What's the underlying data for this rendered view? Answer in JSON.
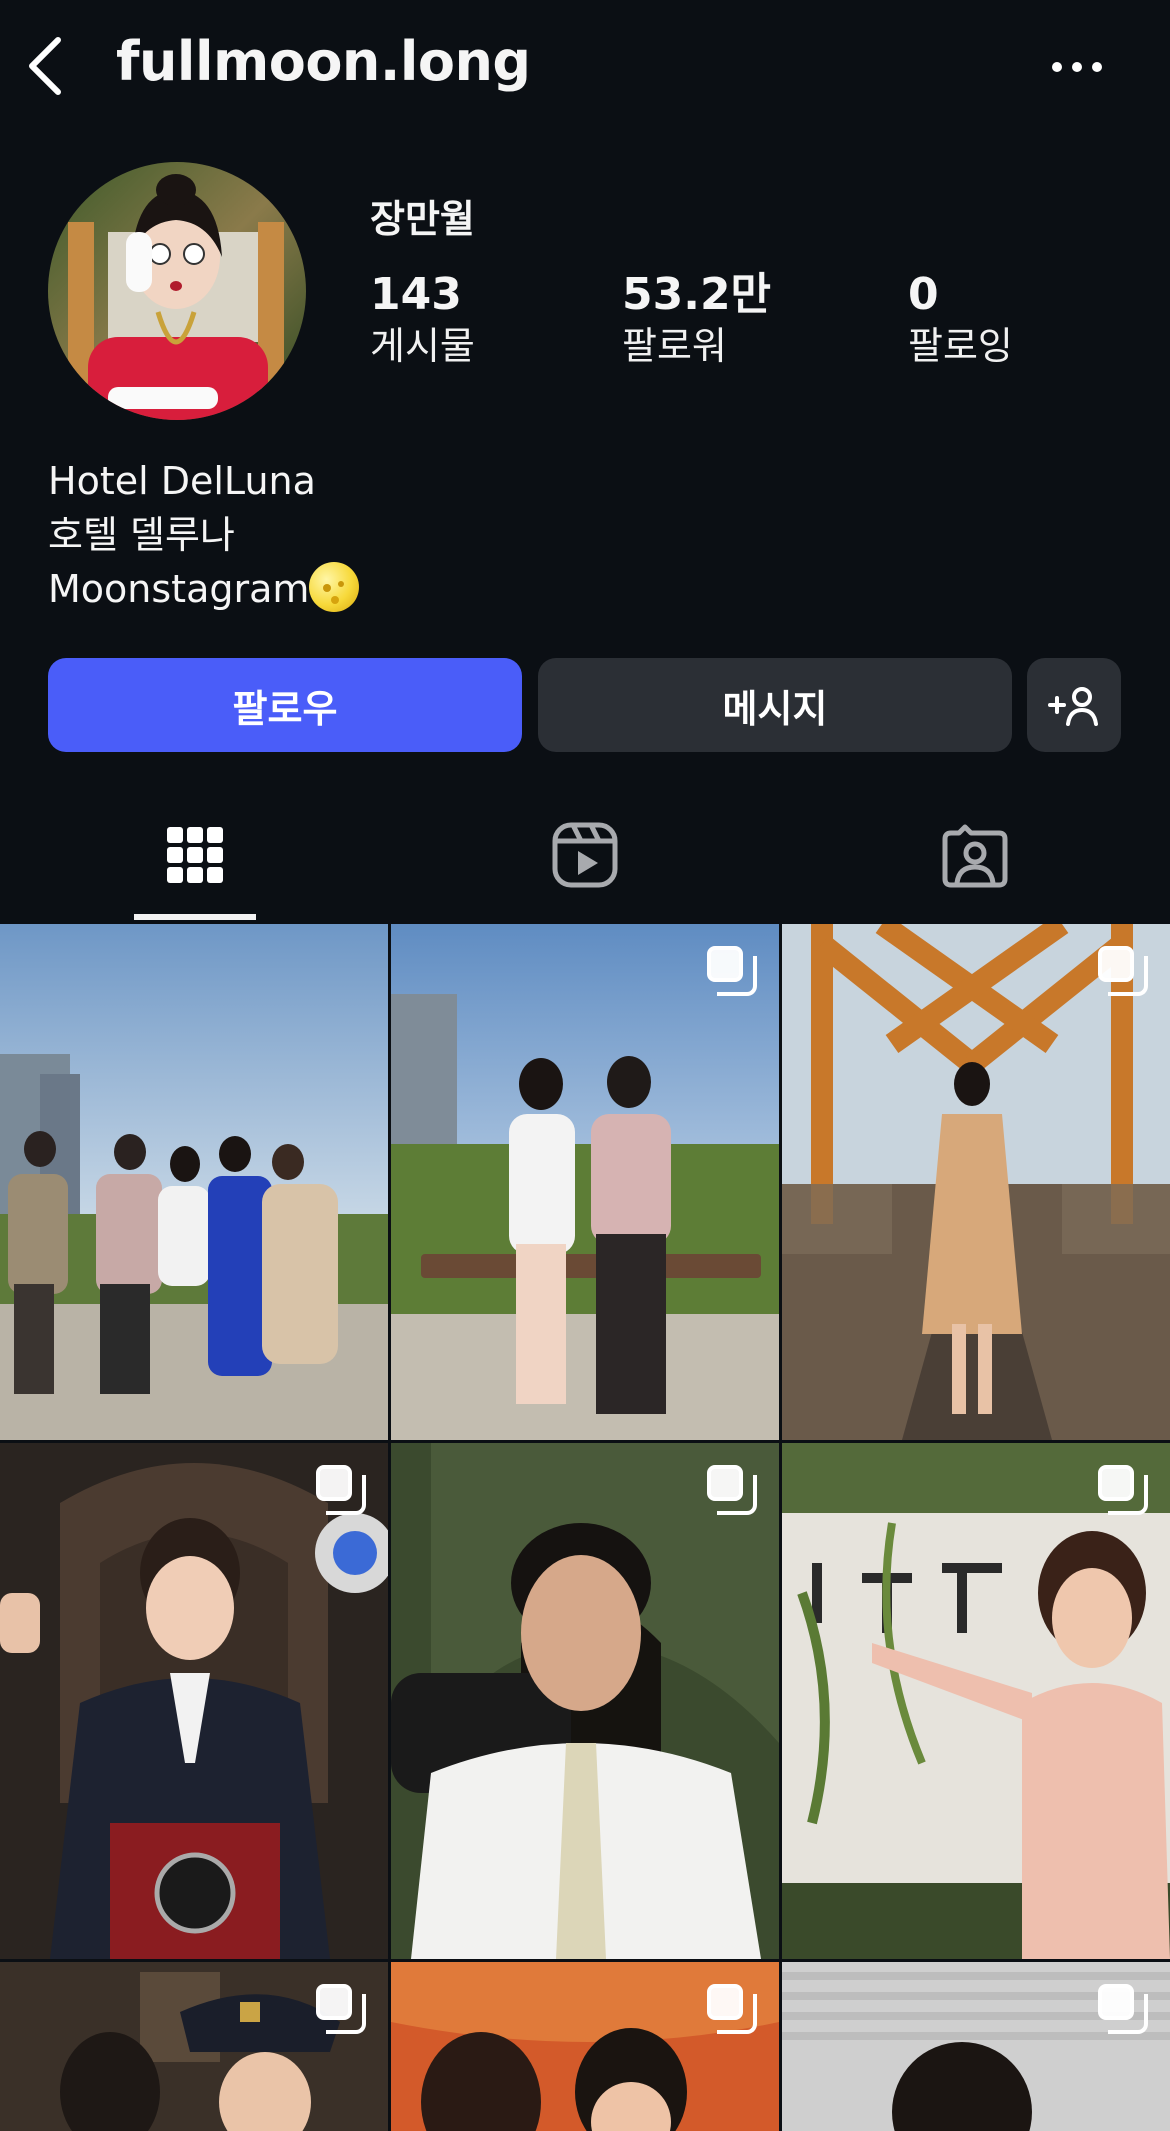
{
  "header": {
    "username": "fullmoon.long",
    "back_icon": "chevron-left-icon",
    "more_icon": "more-horizontal-icon"
  },
  "profile": {
    "display_name": "장만월",
    "stats": [
      {
        "value": "143",
        "label": "게시물"
      },
      {
        "value": "53.2만",
        "label": "팔로워"
      },
      {
        "value": "0",
        "label": "팔로잉"
      }
    ],
    "bio": [
      "Hotel DelLuna",
      "호텔 델루나",
      "Moonstagram"
    ],
    "bio_emoji": "full-moon-face-emoji"
  },
  "actions": {
    "follow_label": "팔로우",
    "message_label": "메시지",
    "suggest_label": "+"
  },
  "tabs": [
    {
      "icon": "grid-icon",
      "selected": true
    },
    {
      "icon": "reels-icon",
      "selected": false
    },
    {
      "icon": "tagged-icon",
      "selected": false
    }
  ],
  "posts": [
    {
      "multi": false
    },
    {
      "multi": true
    },
    {
      "multi": true
    },
    {
      "multi": true
    },
    {
      "multi": true
    },
    {
      "multi": true
    },
    {
      "multi": true
    },
    {
      "multi": true
    },
    {
      "multi": true
    }
  ],
  "colors": {
    "background": "#0b0f14",
    "follow_button": "#4a5df9",
    "secondary_button": "#2b2f35",
    "text": "#f5f5f5"
  }
}
